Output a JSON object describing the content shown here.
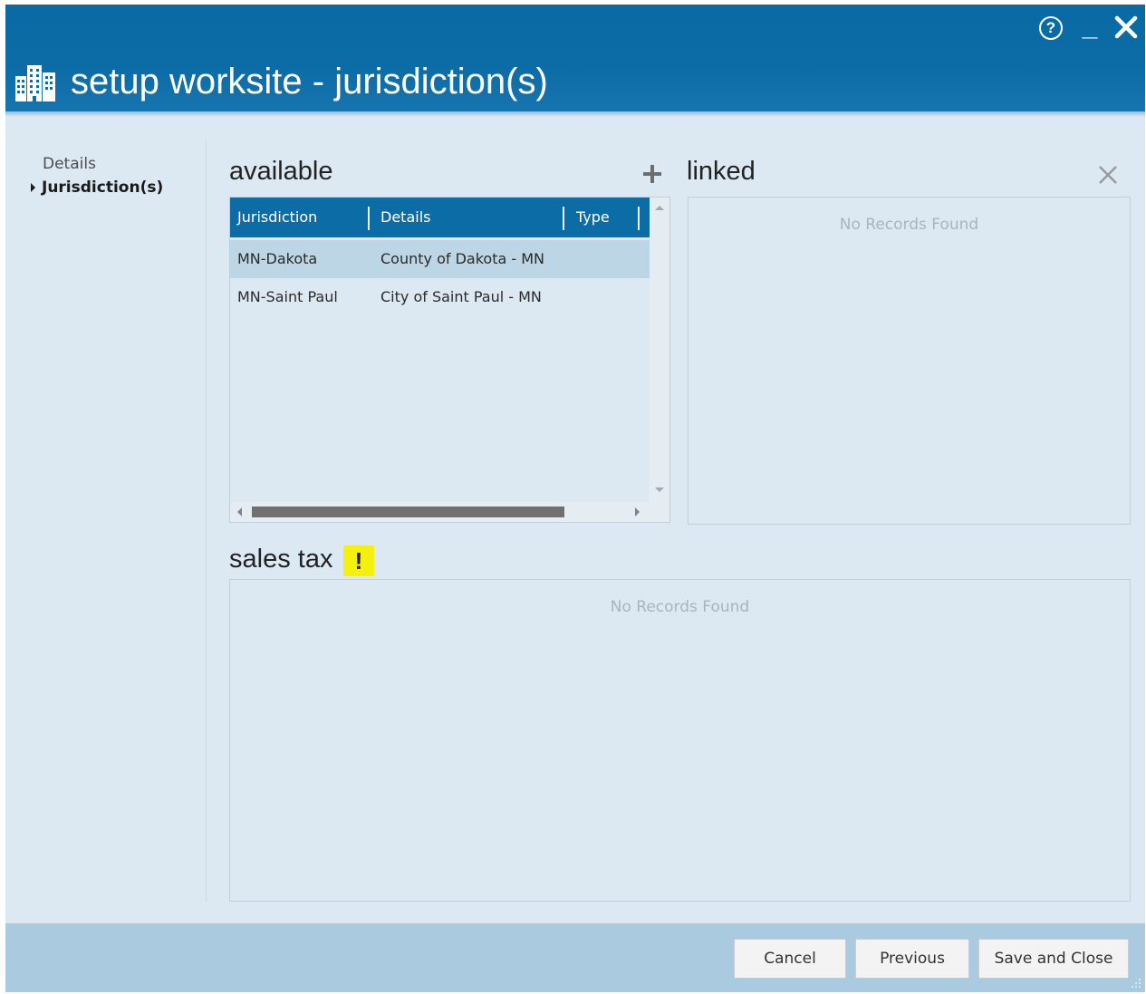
{
  "window": {
    "title": "setup worksite - jurisdiction(s)",
    "help_symbol": "?",
    "minimize_symbol": "_",
    "accent_color": "#0c6ca6",
    "background_color": "#dce9f2",
    "icons": [
      "buildings-icon",
      "help-icon",
      "minimize-icon",
      "close-icon"
    ]
  },
  "sidebar": {
    "items": [
      {
        "label": "Details",
        "active": false
      },
      {
        "label": "Jurisdiction(s)",
        "active": true
      }
    ]
  },
  "available": {
    "title": "available",
    "columns": [
      "Jurisdiction",
      "Details",
      "Type"
    ],
    "rows": [
      {
        "jurisdiction": "MN-Dakota",
        "details": "County of Dakota - MN",
        "type": "",
        "selected": true
      },
      {
        "jurisdiction": "MN-Saint Paul",
        "details": "City of Saint Paul - MN",
        "type": "",
        "selected": false
      }
    ],
    "add_icon": "plus-icon"
  },
  "linked": {
    "title": "linked",
    "empty_text": "No Records Found",
    "remove_icon": "x-icon"
  },
  "sales_tax": {
    "title": "sales tax",
    "warning": "!",
    "warning_color": "#f6f00f",
    "empty_text": "No Records Found"
  },
  "footer": {
    "cancel_label": "Cancel",
    "previous_label": "Previous",
    "save_close_label": "Save and Close"
  }
}
